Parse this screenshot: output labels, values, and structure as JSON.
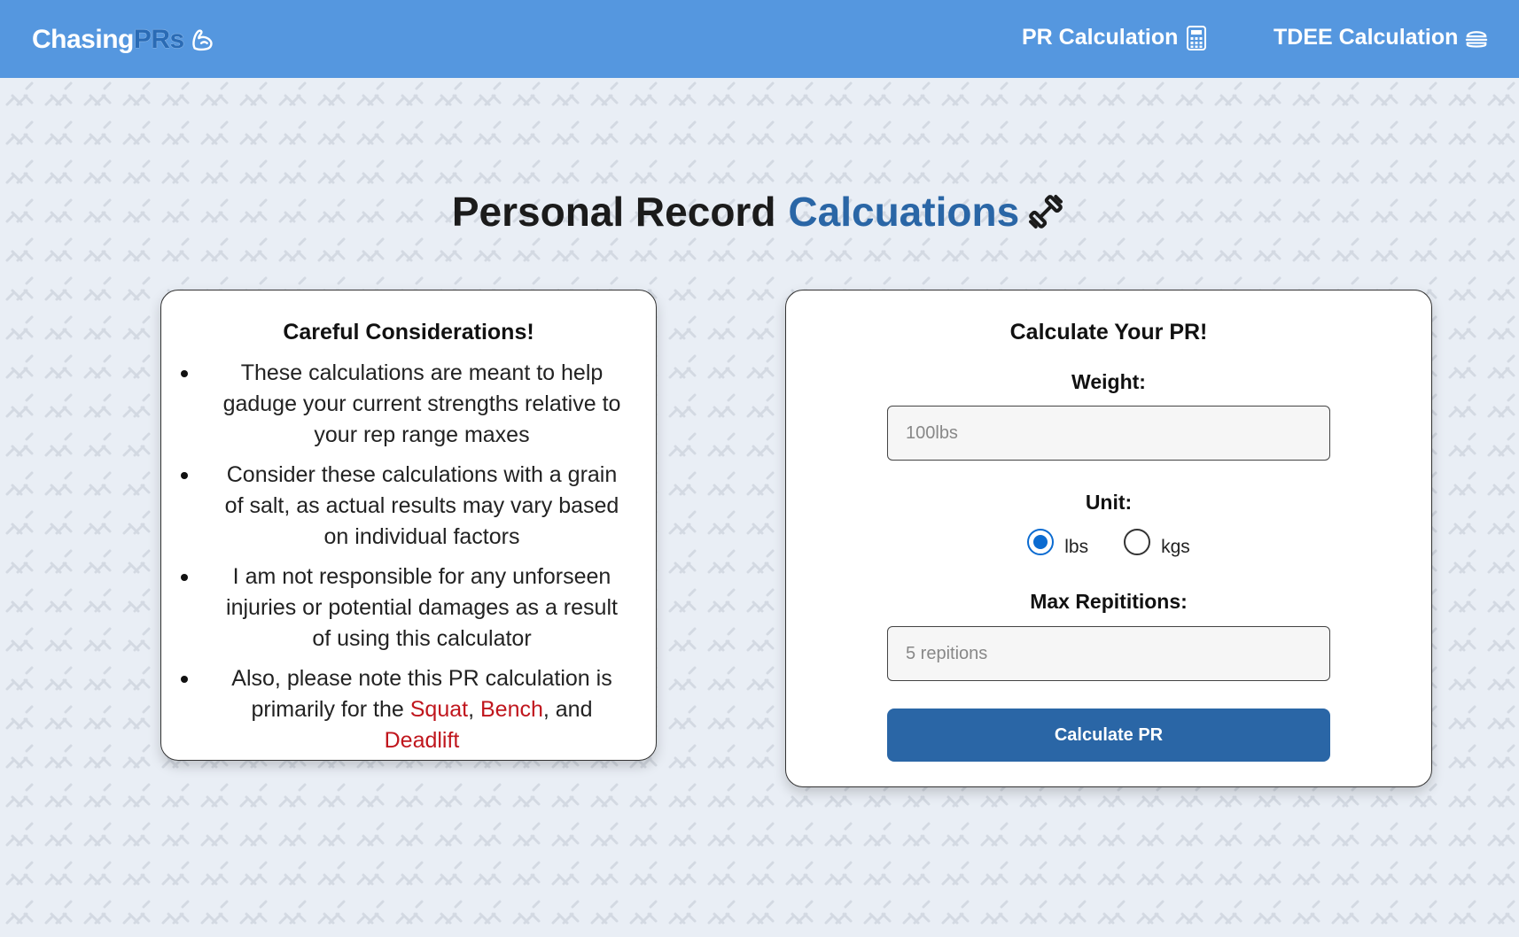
{
  "header": {
    "brand_part1": "Chasing",
    "brand_part2": "PRs",
    "brand_icon": "flexed-bicep-icon",
    "nav": [
      {
        "label": "PR Calculation",
        "icon": "calculator-icon"
      },
      {
        "label": "TDEE Calculation",
        "icon": "burger-icon"
      }
    ]
  },
  "main": {
    "title_part1": "Personal Record",
    "title_part2": "Calcuations",
    "title_icon": "dumbbell-icon"
  },
  "considerations": {
    "heading": "Careful Considerations!",
    "items": [
      "These calculations are meant to help gaduge your current strengths relative to your rep range maxes",
      "Consider these calculations with a grain of salt, as actual results may vary based on individual factors",
      "I am not responsible for any unforseen injuries or potential damages as a result of using this calculator"
    ],
    "last_item": {
      "prefix": "Also, please note this PR calculation is primarily for the",
      "lift1": "Squat",
      "sep1": ",",
      "lift2": "Bench",
      "sep2": ", and",
      "lift3": "Deadlift"
    }
  },
  "form": {
    "heading": "Calculate Your PR!",
    "weight_label": "Weight:",
    "weight_placeholder": "100lbs",
    "unit_label": "Unit:",
    "unit_options": [
      {
        "label": "lbs",
        "checked": true
      },
      {
        "label": "kgs",
        "checked": false
      }
    ],
    "reps_label": "Max Repititions:",
    "reps_placeholder": "5 repitions",
    "submit_label": "Calculate PR"
  },
  "colors": {
    "header_bg": "#5597df",
    "accent": "#2a66a6",
    "lift_highlight": "#c0161d",
    "radio_selected": "#0b6bd1"
  }
}
